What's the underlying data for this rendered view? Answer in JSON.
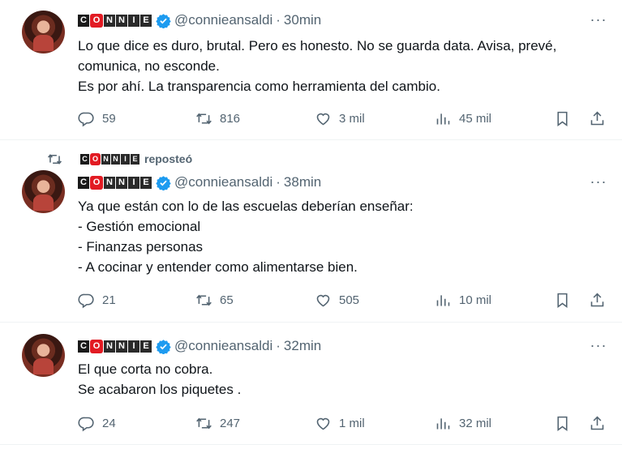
{
  "tweets": [
    {
      "handle": "@connieansaldi",
      "separator": "·",
      "time": "30min",
      "lines": [
        "Lo que dice es duro, brutal. Pero es honesto. No se guarda data. Avisa, prevé,",
        "comunica, no esconde.",
        "Es por ahí. La transparencia como herramienta del cambio."
      ],
      "replies": "59",
      "reposts": "816",
      "likes": "3 mil",
      "views": "45 mil"
    },
    {
      "repost_label": "reposteó",
      "handle": "@connieansaldi",
      "separator": "·",
      "time": "38min",
      "lines": [
        "Ya que están con lo de las escuelas deberían enseñar:",
        "- Gestión emocional",
        "- Finanzas personas",
        "- A cocinar y entender como alimentarse bien."
      ],
      "replies": "21",
      "reposts": "65",
      "likes": "505",
      "views": "10 mil"
    },
    {
      "handle": "@connieansaldi",
      "separator": "·",
      "time": "32min",
      "lines": [
        "El que corta no cobra.",
        "Se acabaron los piquetes ."
      ],
      "replies": "24",
      "reposts": "247",
      "likes": "1 mil",
      "views": "32 mil"
    }
  ],
  "logo_letters": [
    "C",
    "O",
    "N",
    "N",
    "I",
    "E"
  ],
  "more_label": "···",
  "icons": {
    "reply": "reply-icon",
    "repost": "repost-icon",
    "like": "heart-icon",
    "views": "views-icon",
    "bookmark": "bookmark-icon",
    "share": "share-icon",
    "verified": "verified-badge-icon"
  },
  "colors": {
    "text": "#0f1419",
    "muted": "#536471",
    "verified": "#1d9bf0",
    "logo_red": "#e21b23"
  }
}
